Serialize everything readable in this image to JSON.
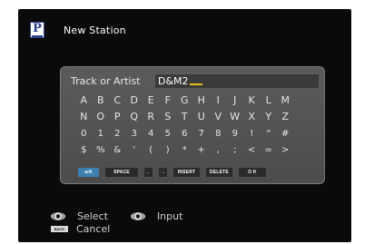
{
  "header": {
    "icon": "preset-p-icon",
    "icon_letter": "P",
    "title": "New Station"
  },
  "field": {
    "label": "Track or Artist",
    "value": "D&M2"
  },
  "keyboard": {
    "rows": [
      [
        "A",
        "B",
        "C",
        "D",
        "E",
        "F",
        "G",
        "H",
        "I",
        "J",
        "K",
        "L",
        "M"
      ],
      [
        "N",
        "O",
        "P",
        "Q",
        "R",
        "S",
        "T",
        "U",
        "V",
        "W",
        "X",
        "Y",
        "Z"
      ],
      [
        "0",
        "1",
        "2",
        "3",
        "4",
        "5",
        "6",
        "7",
        "8",
        "9",
        "!",
        "\"",
        "#"
      ],
      [
        "$",
        "%",
        "&",
        "'",
        "(",
        ")",
        "*",
        "+",
        ",",
        ";",
        "<",
        "=",
        ">"
      ]
    ]
  },
  "buttons": {
    "case": "a/A",
    "space": "SPACE",
    "left": "←",
    "right": "→",
    "insert": "INSERT",
    "delete": "DELETE",
    "ok": "O K"
  },
  "help": {
    "select_label": "Select",
    "input_label": "Input",
    "back_badge": "BACK",
    "cancel_label": "Cancel"
  },
  "colors": {
    "accent": "#3e7fb0",
    "cursor": "#e3c01a",
    "panel": "#555555",
    "screen": "#0a0a0a"
  }
}
